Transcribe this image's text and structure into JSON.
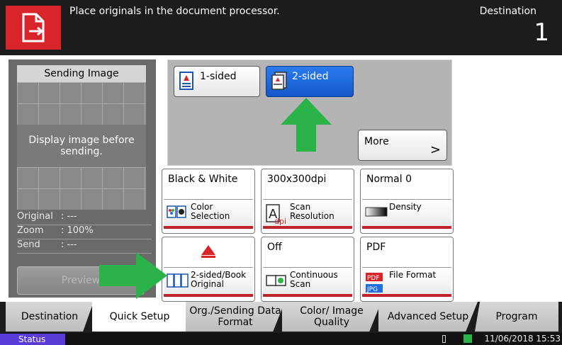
{
  "header": {
    "message": "Place originals in the document processor.",
    "destination_label": "Destination",
    "destination_count": "1"
  },
  "preview": {
    "title": "Sending Image",
    "message": "Display image before sending.",
    "info": [
      {
        "key": "Original",
        "value": ": ---"
      },
      {
        "key": "Zoom",
        "value": ": 100%"
      },
      {
        "key": "Send",
        "value": ": ---"
      }
    ],
    "preview_button": "Preview"
  },
  "sides": {
    "one_sided": "1-sided",
    "two_sided": "2-sided",
    "selected": "2-sided",
    "more": "More"
  },
  "tiles": [
    {
      "value": "Black & White",
      "label": "Color Selection"
    },
    {
      "value": "300x300dpi",
      "label": "Scan Resolution"
    },
    {
      "value": "Normal 0",
      "label": "Density"
    },
    {
      "value": "",
      "label": "2-sided/Book Original"
    },
    {
      "value": "Off",
      "label": "Continuous Scan"
    },
    {
      "value": "PDF",
      "label": "File Format"
    }
  ],
  "tabs": {
    "destination": "Destination",
    "quick_setup": "Quick Setup",
    "org_sending": "Org./Sending Data Format",
    "color_image": "Color/ Image Quality",
    "advanced": "Advanced Setup",
    "program": "Program",
    "active": "Quick Setup"
  },
  "statusbar": {
    "status": "Status",
    "datetime": "11/06/2018  15:53"
  },
  "colors": {
    "accent_red": "#d9252a",
    "selected_blue": "#1f6de0",
    "highlight_green": "#2bb34a"
  },
  "icons": [
    "document-exit-icon",
    "one-sided-doc-icon",
    "two-sided-doc-icon",
    "chevron-right-icon",
    "color-selection-icon",
    "scan-resolution-icon",
    "density-icon",
    "warning-triangle-icon",
    "book-original-icon",
    "continuous-scan-icon",
    "file-format-icon",
    "memory-icon"
  ]
}
